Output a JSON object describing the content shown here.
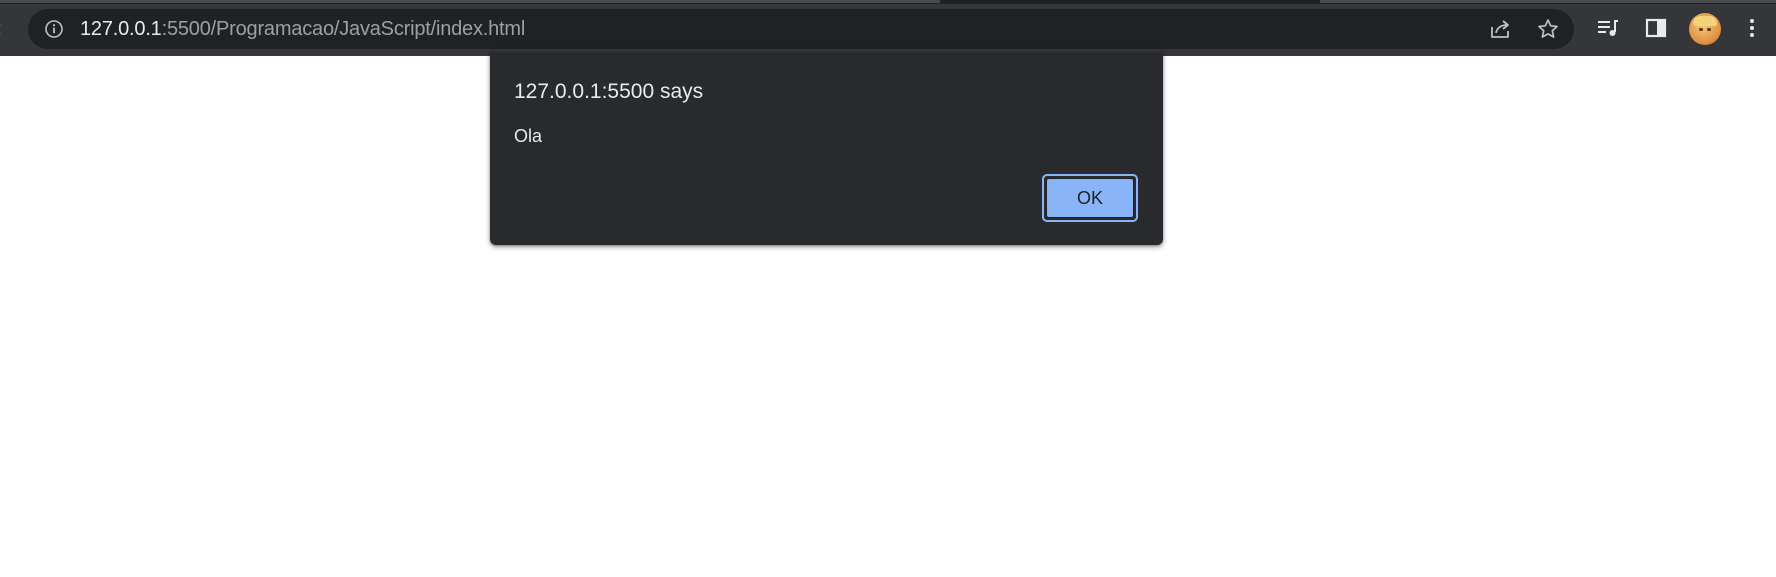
{
  "browser": {
    "address_host": "127.0.0.1",
    "address_path": ":5500/Programacao/JavaScript/index.html",
    "icons": {
      "site_info": "info-icon",
      "share": "share-icon",
      "bookmark": "star-icon",
      "reading_list": "media-queue-icon",
      "side_panel": "side-panel-icon",
      "profile": "avatar",
      "menu": "more-vertical-icon"
    }
  },
  "alert": {
    "title": "127.0.0.1:5500 says",
    "message": "Ola",
    "ok_label": "OK"
  },
  "colors": {
    "toolbar": "#35363a",
    "omnibox": "#202124",
    "dialog": "#292a2d",
    "accent": "#8ab4f8"
  }
}
